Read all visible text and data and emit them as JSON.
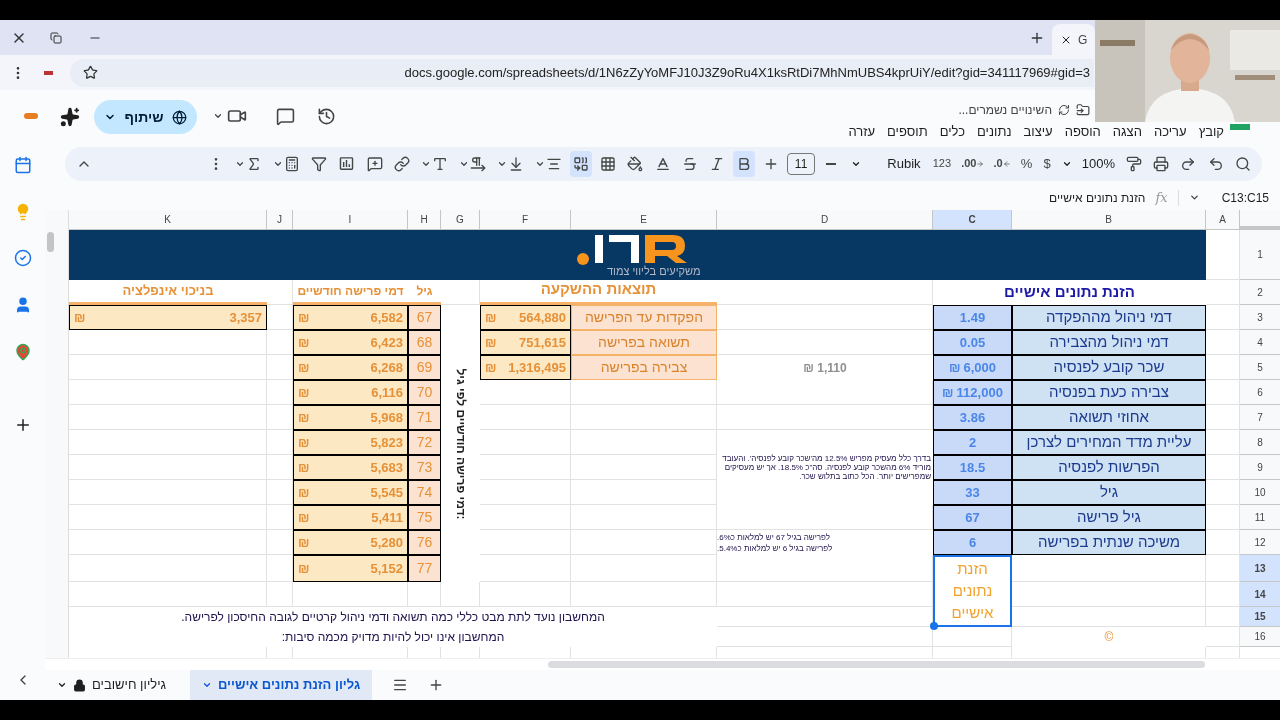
{
  "browser": {
    "tab_title": "G",
    "url": "docs.google.com/spreadsheets/d/1N6zZyYoMFJ10J3Z9oRu4X1ksRtDi7MhNmUBS4kprUiY/edit?gid=341117969#gid=3"
  },
  "header": {
    "save_status": "השינויים נשמרים...",
    "share_label": "שיתוף",
    "menu": [
      "קובץ",
      "עריכה",
      "הצגה",
      "הוספה",
      "עיצוב",
      "נתונים",
      "כלים",
      "תוספים",
      "עזרה"
    ]
  },
  "toolbar": {
    "zoom": "100%",
    "currency": "$",
    "percent": "%",
    "decimals": [
      ".0",
      ".00"
    ],
    "number_format": "123",
    "font": "Rubik",
    "font_size": "11",
    "bold_selected": true,
    "merge_selected": true
  },
  "formula_bar": {
    "cell_ref": "C13:C15",
    "function_label": "fx",
    "content": "הזנת נתונים אישיים"
  },
  "sheet": {
    "columns": [
      {
        "label": "A",
        "selected": false
      },
      {
        "label": "B",
        "selected": false
      },
      {
        "label": "C",
        "selected": true
      },
      {
        "label": "D",
        "selected": false
      },
      {
        "label": "E",
        "selected": false
      },
      {
        "label": "F",
        "selected": false
      },
      {
        "label": "G",
        "selected": false
      },
      {
        "label": "H",
        "selected": false
      },
      {
        "label": "I",
        "selected": false
      },
      {
        "label": "J",
        "selected": false
      },
      {
        "label": "K",
        "selected": false
      }
    ],
    "rows": [
      {
        "label": "1",
        "selected": false
      },
      {
        "label": "2",
        "selected": false
      },
      {
        "label": "3",
        "selected": false
      },
      {
        "label": "4",
        "selected": false
      },
      {
        "label": "5",
        "selected": false
      },
      {
        "label": "6",
        "selected": false
      },
      {
        "label": "7",
        "selected": false
      },
      {
        "label": "8",
        "selected": false
      },
      {
        "label": "9",
        "selected": false
      },
      {
        "label": "10",
        "selected": false
      },
      {
        "label": "11",
        "selected": false
      },
      {
        "label": "12",
        "selected": false
      },
      {
        "label": "13",
        "selected": true
      },
      {
        "label": "14",
        "selected": true
      },
      {
        "label": "15",
        "selected": true
      },
      {
        "label": "16",
        "selected": false
      }
    ],
    "logo": {
      "tagline": "משקיעים בליווי צמוד"
    },
    "personal": {
      "title": "הזנת נתונים אישיים",
      "items": [
        {
          "label": "דמי ניהול מההפקדה",
          "value": "1.49"
        },
        {
          "label": "דמי ניהול מהצבירה",
          "value": "0.05"
        },
        {
          "label": "שכר קובע לפנסיה",
          "value": "6,000",
          "currency": "₪"
        },
        {
          "label": "צבירה כעת בפנסיה",
          "value": "112,000",
          "currency": "₪"
        },
        {
          "label": "אחוזי תשואה",
          "value": "3.86"
        },
        {
          "label": "עליית מדד המחירים לצרכן",
          "value": "2"
        },
        {
          "label": "הפרשות לפנסיה",
          "value": "18.5"
        },
        {
          "label": "גיל",
          "value": "33"
        },
        {
          "label": "גיל פרישה",
          "value": "67"
        },
        {
          "label": "משיכה שנתית בפרישה",
          "value": "6"
        }
      ]
    },
    "results": {
      "title": "תוצאות ההשקעה",
      "items": [
        {
          "label": "הפקדות עד הפרישה",
          "value": "564,880",
          "currency": "₪"
        },
        {
          "label": "תשואה בפרישה",
          "value": "751,615",
          "currency": "₪"
        },
        {
          "label": "צבירה בפרישה",
          "value": "1,316,495",
          "currency": "₪"
        }
      ]
    },
    "monthly": {
      "age_header": "גיל",
      "amount_header": "דמי פרישה חודשיים",
      "vertical_label": "דמי פרישה חודשיים לפי גיל:",
      "rows": [
        {
          "age": "67",
          "amount": "6,582",
          "currency": "₪"
        },
        {
          "age": "68",
          "amount": "6,423",
          "currency": "₪"
        },
        {
          "age": "69",
          "amount": "6,268",
          "currency": "₪"
        },
        {
          "age": "70",
          "amount": "6,116",
          "currency": "₪"
        },
        {
          "age": "71",
          "amount": "5,968",
          "currency": "₪"
        },
        {
          "age": "72",
          "amount": "5,823",
          "currency": "₪"
        },
        {
          "age": "73",
          "amount": "5,683",
          "currency": "₪"
        },
        {
          "age": "74",
          "amount": "5,545",
          "currency": "₪"
        },
        {
          "age": "75",
          "amount": "5,411",
          "currency": "₪"
        },
        {
          "age": "76",
          "amount": "5,280",
          "currency": "₪"
        },
        {
          "age": "77",
          "amount": "5,152",
          "currency": "₪"
        }
      ]
    },
    "inflation": {
      "header": "בניכוי אינפלציה",
      "value": "3,357",
      "currency": "₪"
    },
    "d5_value": "₪ 1,110",
    "note_contribution": "בדרך כלל מעסיק מפריש 12.5% מה'שכר קובע לפנסיה'. והעובד מוריד 6% מהשכר קובע לפנסיה. סה\"כ 18.5%. אך יש מעסיקים שמפרישים יותר. הכל כתוב בתלוש שכר.",
    "note_withdrawal": [
      "לפרישה בגיל 67 יש למלאות כ6%.",
      "לפרישה בגיל 6 יש למלאות כ5.4%."
    ],
    "selection_text": "הזנת נתונים אישיים",
    "footer_lines": [
      "המחשבון נועד לתת מבט כללי כמה תשואה ודמי ניהול קרטיים לגובה החיסכון לפרישה.",
      "המחשבון אינו יכול להיות מדויק מכמה סיבות:"
    ],
    "copyright": "©"
  },
  "sheet_tabs": [
    {
      "label": "גליון הזנת נתונים אישיים",
      "selected": true,
      "locked": false
    },
    {
      "label": "גיליון חישובים",
      "selected": false,
      "locked": true
    }
  ]
}
